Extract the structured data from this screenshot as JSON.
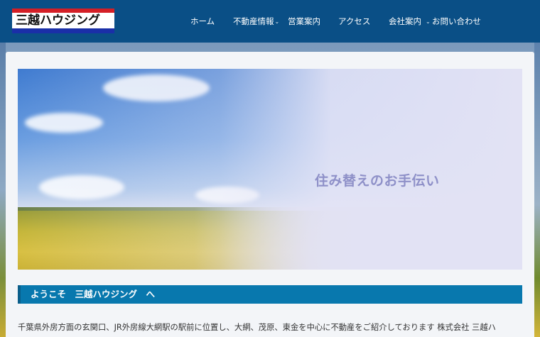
{
  "header": {
    "logo_text": "三越ハウジング",
    "nav": [
      {
        "label": "ホーム",
        "has_submenu": false
      },
      {
        "label": "不動産情報",
        "has_submenu": true
      },
      {
        "label": "営業案内",
        "has_submenu": false
      },
      {
        "label": "アクセス",
        "has_submenu": false
      },
      {
        "label": "会社案内",
        "has_submenu": true
      },
      {
        "label": "お問い合わせ",
        "has_submenu": false
      }
    ]
  },
  "hero": {
    "caption": "住み替えのお手伝い"
  },
  "welcome": {
    "title": "ようこそ　三越ハウジング　へ",
    "intro": "千葉県外房方面の玄関口、JR外房線大網駅の駅前に位置し、大網、茂原、東金を中心に不動産をご紹介しております 株式会社 三越ハ"
  },
  "colors": {
    "header_bg": "#0a4f86",
    "section_bar": "#0878ae",
    "logo_red": "#d41f26",
    "logo_blue": "#1a2fa8"
  },
  "icons": {
    "submenu_indicator": "chevron-down-icon"
  }
}
